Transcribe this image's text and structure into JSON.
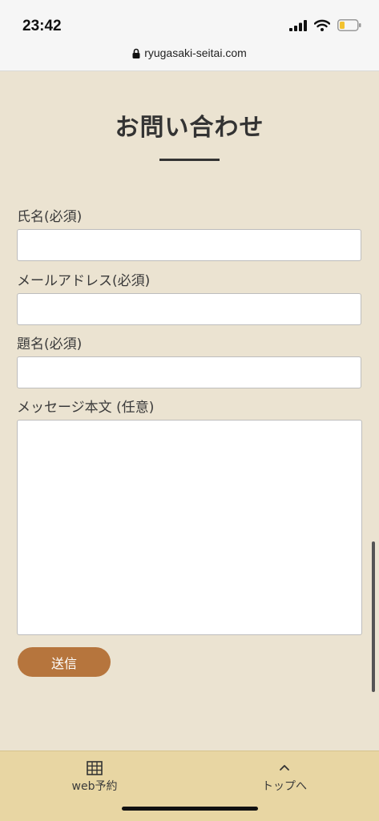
{
  "status_bar": {
    "time": "23:42",
    "icons": [
      "signal-icon",
      "wifi-icon",
      "battery-icon"
    ],
    "url": "ryugasaki-seitai.com"
  },
  "page": {
    "title": "お問い合わせ"
  },
  "form": {
    "name_label": "氏名(必須)",
    "name_value": "",
    "email_label": "メールアドレス(必須)",
    "email_value": "",
    "subject_label": "題名(必須)",
    "subject_value": "",
    "message_label": "メッセージ本文 (任意)",
    "message_value": "",
    "submit_label": "送信"
  },
  "bottom_nav": {
    "reserve": {
      "label": "web予約",
      "icon": "calendar-grid-icon"
    },
    "top": {
      "label": "トップへ",
      "icon": "chevron-up-icon"
    }
  },
  "colors": {
    "page_background": "#ebe3d1",
    "button": "#b6753d",
    "bottom_bar": "#e8d6a3"
  }
}
